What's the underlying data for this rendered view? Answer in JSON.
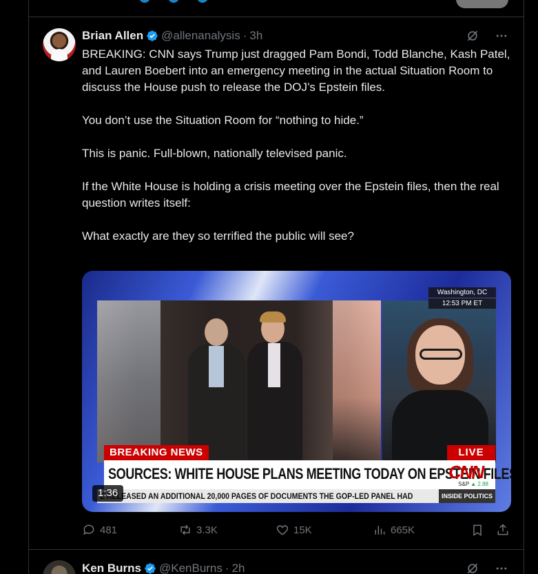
{
  "tweet": {
    "author_name": "Brian Allen",
    "handle": "@allenanalysis",
    "separator": "·",
    "time": "3h",
    "paragraphs": [
      "BREAKING: CNN says Trump just dragged Pam Bondi, Todd Blanche, Kash Patel, and Lauren Boebert into an emergency meeting in the actual Situation Room to discuss the House push to release the DOJ’s Epstein files.",
      "You don’t use the Situation Room for “nothing to hide.”",
      "This is panic. Full-blown, nationally televised panic.",
      "If the White House is holding a crisis meeting over the Epstein files, then the real question writes itself:",
      "What exactly are they so terrified the public will see?"
    ],
    "media": {
      "location": "Washington, DC",
      "clock": "12:53 PM ET",
      "breaking_label": "BREAKING NEWS",
      "live_label": "LIVE",
      "headline": "SOURCES: WHITE HOUSE PLANS MEETING TODAY ON EPSTEIN FILES",
      "network_logo": "CNN",
      "market_label": "S&P",
      "market_value": "▲ 2.88",
      "ticker": "E RELEASED AN ADDITIONAL 20,000 PAGES OF DOCUMENTS THE GOP-LED PANEL HAD",
      "ticker_tag": "INSIDE POLITICS",
      "duration": "1:36"
    },
    "stats": {
      "replies": "481",
      "reposts": "3.3K",
      "likes": "15K",
      "views": "665K"
    }
  },
  "next_tweet": {
    "author_name": "Ken Burns",
    "handle": "@KenBurns",
    "separator": "·",
    "time": "2h"
  },
  "colors": {
    "background": "#000000",
    "text_primary": "#e7e9ea",
    "text_secondary": "#71767b",
    "verified": "#1d9bf0",
    "border": "#2f3336",
    "cnn_red": "#cc0000"
  }
}
